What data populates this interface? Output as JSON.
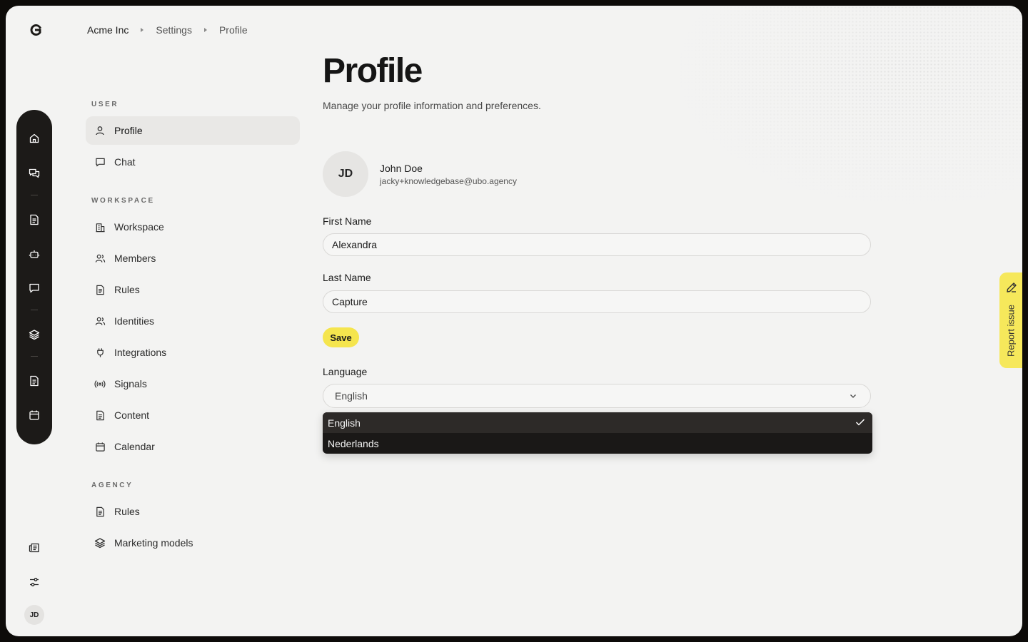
{
  "brand": {
    "logo_icon": "brand-g-logo-icon"
  },
  "breadcrumb": [
    "Acme Inc",
    "Settings",
    "Profile"
  ],
  "rail": {
    "icons": [
      "home-icon",
      "conversations-icon",
      "document-icon",
      "robot-icon",
      "message-icon",
      "layers-icon",
      "document-icon",
      "calendar-icon"
    ]
  },
  "bottom": {
    "icons": [
      "newspaper-icon",
      "sliders-icon"
    ],
    "avatar_initials": "JD"
  },
  "nav": {
    "sections": [
      {
        "title": "USER",
        "items": [
          {
            "label": "Profile",
            "icon": "user-icon",
            "active": true
          },
          {
            "label": "Chat",
            "icon": "message-icon"
          }
        ]
      },
      {
        "title": "WORKSPACE",
        "items": [
          {
            "label": "Workspace",
            "icon": "building-icon"
          },
          {
            "label": "Members",
            "icon": "users-icon"
          },
          {
            "label": "Rules",
            "icon": "document-icon"
          },
          {
            "label": "Identities",
            "icon": "users-icon"
          },
          {
            "label": "Integrations",
            "icon": "plug-icon"
          },
          {
            "label": "Signals",
            "icon": "broadcast-icon"
          },
          {
            "label": "Content",
            "icon": "document-icon"
          },
          {
            "label": "Calendar",
            "icon": "calendar-icon"
          }
        ]
      },
      {
        "title": "AGENCY",
        "items": [
          {
            "label": "Rules",
            "icon": "document-icon"
          },
          {
            "label": "Marketing models",
            "icon": "layers-icon"
          }
        ]
      }
    ]
  },
  "page": {
    "title": "Profile",
    "subtitle": "Manage your profile information and preferences."
  },
  "profile": {
    "initials": "JD",
    "name": "John Doe",
    "email": "jacky+knowledgebase@ubo.agency"
  },
  "form": {
    "first_name_label": "First Name",
    "first_name_value": "Alexandra",
    "last_name_label": "Last Name",
    "last_name_value": "Capture",
    "save_label": "Save",
    "language_label": "Language",
    "language_value": "English",
    "language_options": [
      "English",
      "Nederlands"
    ],
    "language_selected": "English"
  },
  "report": {
    "label": "Report issue",
    "icon": "pencil-icon"
  },
  "colors": {
    "accent": "#f5e54e",
    "rail": "#1c1a18",
    "dropdown": "#1a1817"
  }
}
